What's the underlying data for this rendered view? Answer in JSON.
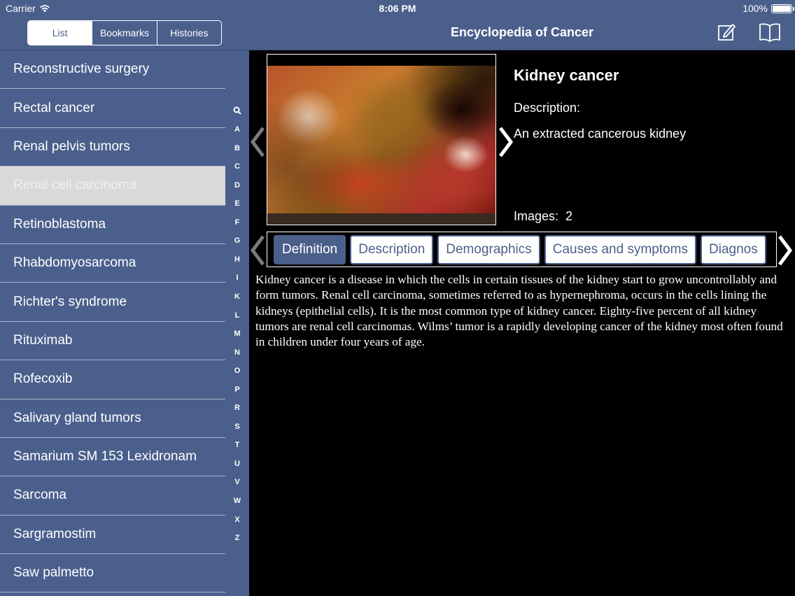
{
  "status_bar": {
    "carrier": "Carrier",
    "time": "8:06 PM",
    "battery": "100%",
    "battery_level": 1.0
  },
  "sidebar": {
    "segments": [
      {
        "label": "List",
        "active": true
      },
      {
        "label": "Bookmarks",
        "active": false
      },
      {
        "label": "Histories",
        "active": false
      }
    ],
    "items": [
      {
        "label": "Reconstructive surgery",
        "selected": false
      },
      {
        "label": "Rectal cancer",
        "selected": false
      },
      {
        "label": "Renal pelvis tumors",
        "selected": false
      },
      {
        "label": "Renal cell carcinoma",
        "selected": true
      },
      {
        "label": "Retinoblastoma",
        "selected": false
      },
      {
        "label": "Rhabdomyosarcoma",
        "selected": false
      },
      {
        "label": "Richter's syndrome",
        "selected": false
      },
      {
        "label": "Rituximab",
        "selected": false
      },
      {
        "label": "Rofecoxib",
        "selected": false
      },
      {
        "label": "Salivary gland tumors",
        "selected": false
      },
      {
        "label": "Samarium SM 153 Lexidronam",
        "selected": false
      },
      {
        "label": "Sarcoma",
        "selected": false
      },
      {
        "label": "Sargramostim",
        "selected": false
      },
      {
        "label": "Saw palmetto",
        "selected": false
      }
    ],
    "index_letters": [
      "A",
      "B",
      "C",
      "D",
      "E",
      "F",
      "G",
      "H",
      "I",
      "K",
      "L",
      "M",
      "N",
      "O",
      "P",
      "R",
      "S",
      "T",
      "U",
      "V",
      "W",
      "X",
      "Z"
    ],
    "index_search_icon": "search-icon"
  },
  "navbar": {
    "title": "Encyclopedia of Cancer",
    "icons": [
      "compose-icon",
      "book-icon"
    ]
  },
  "detail": {
    "title": "Kidney cancer",
    "description_label": "Description:",
    "description_value": "An extracted cancerous kidney",
    "images_label": "Images:",
    "images_count": "2",
    "image_icon": "kidney-photo"
  },
  "tabs": [
    {
      "label": "Definition",
      "active": true
    },
    {
      "label": "Description",
      "active": false
    },
    {
      "label": "Demographics",
      "active": false
    },
    {
      "label": "Causes and symptoms",
      "active": false
    },
    {
      "label": "Diagnos",
      "active": false
    }
  ],
  "article": {
    "text": "Kidney cancer is a disease in which the cells in certain tissues of the kidney start to grow uncontrollably and form tumors. Renal cell carcinoma, sometimes referred to as hypernephroma, occurs in the cells lining the kidneys (epithelial cells). It is the most common type of kidney cancer. Eighty-five percent of all kidney tumors are renal cell carcinomas. Wilms’ tumor is a rapidly developing cancer of the kidney most often found in children under four years of age."
  },
  "colors": {
    "accent": "#4b5f8b",
    "selected_row": "#d9d9d9",
    "background": "#000000"
  }
}
